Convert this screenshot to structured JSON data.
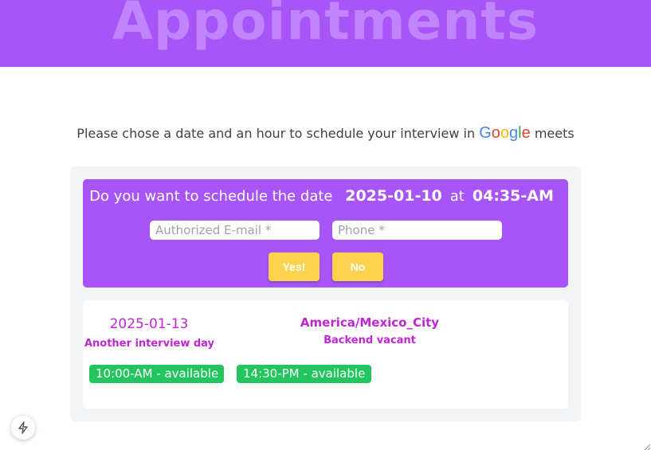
{
  "header": {
    "title": "Appointments"
  },
  "intro": {
    "text": "Please chose a date and an hour to schedule your interview in",
    "brand_letters": [
      "G",
      "o",
      "o",
      "g",
      "l",
      "e"
    ],
    "suffix": "meets"
  },
  "confirm": {
    "question": "Do you want to schedule the date",
    "date": "2025-01-10",
    "at": "at",
    "time": "04:35-AM",
    "email_placeholder": "Authorized E-mail *",
    "phone_placeholder": "Phone *",
    "yes_label": "Yes!",
    "no_label": "No"
  },
  "day": {
    "date": "2025-01-13",
    "subtitle": "Another interview day",
    "timezone": "America/Mexico_City",
    "vacant": "Backend vacant",
    "slots": [
      {
        "time": "10:00-AM",
        "status": " - available"
      },
      {
        "time": "14:30-PM",
        "status": " - available"
      }
    ]
  },
  "colors": {
    "accent": "#a855f7",
    "button": "#fcd34d",
    "slot": "#22c55e",
    "text_highlight": "#c026d3"
  },
  "icons": {
    "floating": "lightning-bolt-icon",
    "corner": "resize-grip-icon"
  }
}
